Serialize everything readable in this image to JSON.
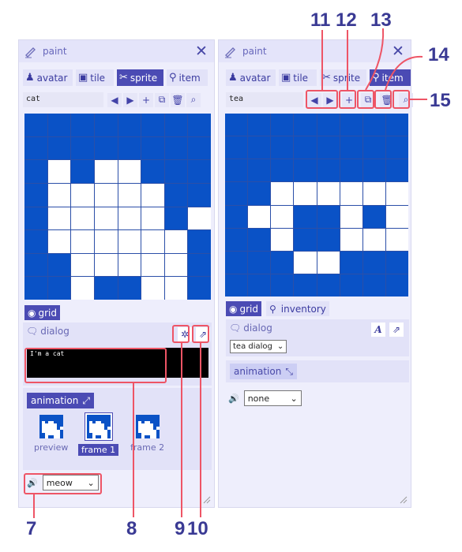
{
  "panels": {
    "left": {
      "title": "paint",
      "tabs": [
        {
          "label": "avatar",
          "icon": "avatar-icon",
          "glyph": "♟"
        },
        {
          "label": "tile",
          "icon": "tile-icon",
          "glyph": "▣"
        },
        {
          "label": "sprite",
          "icon": "sprite-icon",
          "glyph": "✂"
        },
        {
          "label": "item",
          "icon": "item-icon",
          "glyph": "⚲"
        }
      ],
      "active_tab": 2,
      "name_value": "cat",
      "grid_label": "grid",
      "dialog_label": "dialog",
      "dialog_text": "I'm a cat",
      "animation_label": "animation",
      "frames": [
        {
          "label": "preview"
        },
        {
          "label": "frame 1"
        },
        {
          "label": "frame 2"
        }
      ],
      "sound_value": "meow",
      "pixels": [
        "00000000",
        "00000000",
        "01011000",
        "01111100",
        "01111101",
        "01111110",
        "00111110",
        "00100110"
      ]
    },
    "right": {
      "title": "paint",
      "tabs": [
        {
          "label": "avatar",
          "icon": "avatar-icon",
          "glyph": "♟"
        },
        {
          "label": "tile",
          "icon": "tile-icon",
          "glyph": "▣"
        },
        {
          "label": "sprite",
          "icon": "sprite-icon",
          "glyph": "✂"
        },
        {
          "label": "item",
          "icon": "item-icon",
          "glyph": "⚲"
        }
      ],
      "active_tab": 3,
      "name_value": "tea",
      "grid_label": "grid",
      "inventory_label": "inventory",
      "dialog_label": "dialog",
      "dialog_select": "tea dialog",
      "animation_label": "animation",
      "sound_value": "none",
      "pixels": [
        "00000000",
        "00000000",
        "00000000",
        "00111111",
        "01100101",
        "00100111",
        "00011000",
        "00000000"
      ]
    }
  },
  "annotations": [
    "7",
    "8",
    "9",
    "10",
    "11",
    "12",
    "13",
    "14",
    "15"
  ],
  "colors": {
    "accent": "#4b4bb4",
    "sprite_blue": "#0a52c6",
    "highlight": "#ee5566"
  }
}
